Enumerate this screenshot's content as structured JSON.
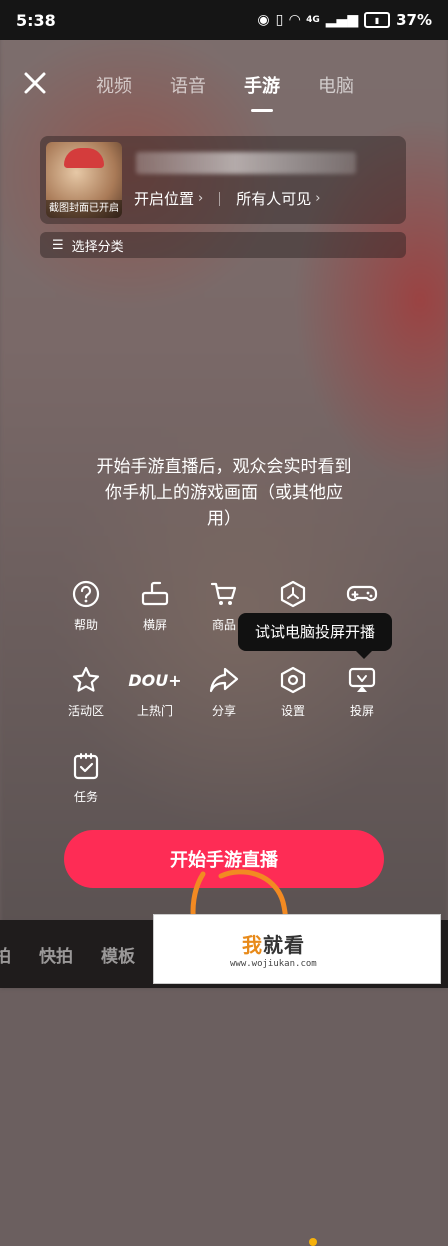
{
  "status_bar": {
    "time": "5:38",
    "network": "4G",
    "battery": "37%"
  },
  "tabs": [
    {
      "label": "视频",
      "active": false
    },
    {
      "label": "语音",
      "active": false
    },
    {
      "label": "手游",
      "active": true
    },
    {
      "label": "电脑",
      "active": false
    }
  ],
  "cover": {
    "label": "截图封面已开启"
  },
  "meta": {
    "location": "开启位置",
    "visibility": "所有人可见"
  },
  "category": {
    "label": "选择分类"
  },
  "hint": {
    "line1": "开始手游直播后，观众会实时看到",
    "line2": "你手机上的游戏画面（或其他应",
    "line3": "用）"
  },
  "tools": [
    {
      "label": "帮助",
      "icon": "help-icon"
    },
    {
      "label": "横屏",
      "icon": "landscape-icon"
    },
    {
      "label": "商品",
      "icon": "cart-icon"
    },
    {
      "label": "",
      "icon": "hexagon-icon"
    },
    {
      "label": "",
      "icon": "gamepad-icon"
    },
    {
      "label": "活动区",
      "icon": "star-icon"
    },
    {
      "label": "上热门",
      "icon": "dou-icon",
      "icon_text": "DOU+"
    },
    {
      "label": "分享",
      "icon": "share-icon"
    },
    {
      "label": "设置",
      "icon": "settings-icon"
    },
    {
      "label": "投屏",
      "icon": "cast-icon"
    },
    {
      "label": "任务",
      "icon": "task-icon"
    }
  ],
  "tooltip": {
    "text": "试试电脑投屏开播"
  },
  "start_button": {
    "label": "开始手游直播"
  },
  "bottom_nav": {
    "items": [
      "拍",
      "快拍",
      "模板"
    ]
  },
  "watermark": {
    "title_highlight": "我",
    "title_rest": "就看",
    "url": "www.wojiukan.com"
  },
  "colors": {
    "accent": "#fe2c55",
    "badge": "#f6b10b"
  }
}
